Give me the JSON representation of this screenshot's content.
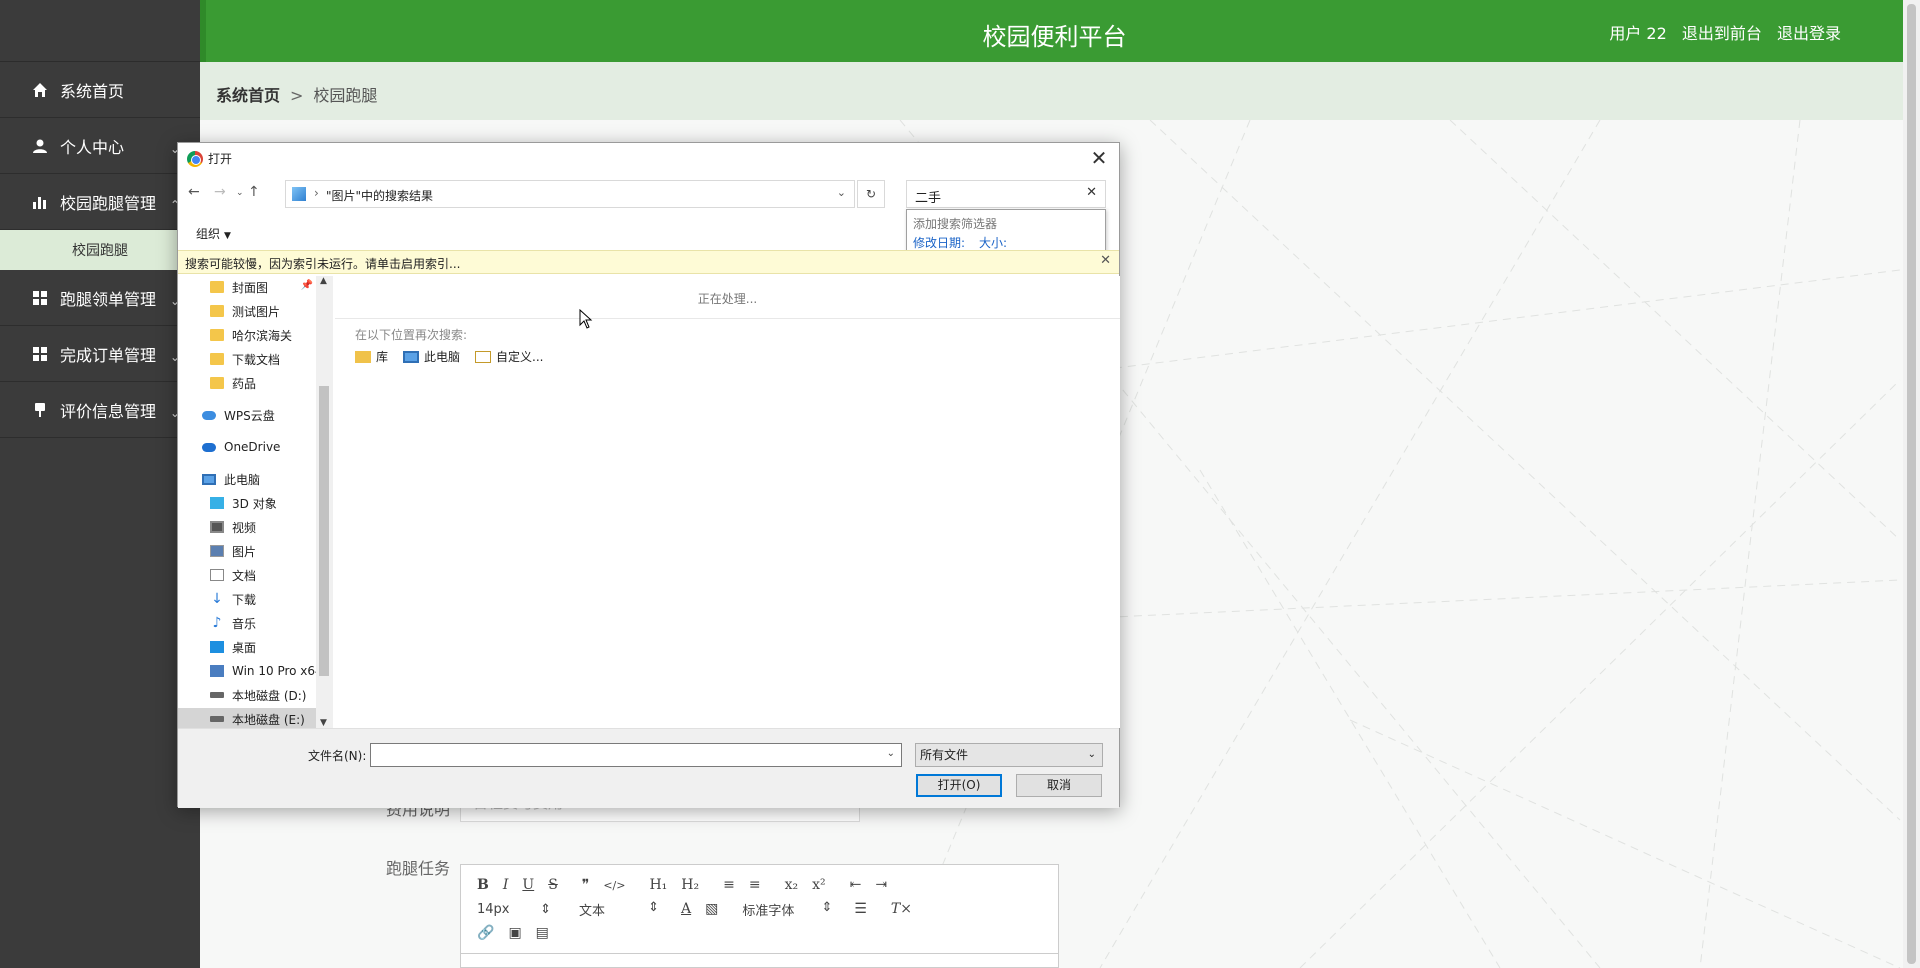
{
  "app": {
    "title": "校园便利平台",
    "user": "用户 22",
    "to_front": "退出到前台",
    "logout": "退出登录"
  },
  "sidebar": {
    "items": [
      {
        "label": "系统首页",
        "icon": "home-icon"
      },
      {
        "label": "个人中心",
        "icon": "user-icon"
      },
      {
        "label": "校园跑腿管理",
        "icon": "bar-chart-icon"
      },
      {
        "label": "跑腿领单管理",
        "icon": "grid-icon"
      },
      {
        "label": "完成订单管理",
        "icon": "grid-icon"
      },
      {
        "label": "评价信息管理",
        "icon": "pin-icon"
      }
    ],
    "sub_item": "校园跑腿"
  },
  "breadcrumb": {
    "home": "系统首页",
    "separator": ">",
    "current": "校园跑腿"
  },
  "form": {
    "fee_label": "费用说明",
    "fee_placeholder": "日程费与费用",
    "task_label": "跑腿任务",
    "editor": {
      "font_size": "14px",
      "block_type": "文本",
      "font_family": "标准字体",
      "toolbar_buttons": [
        "B",
        "I",
        "U",
        "S",
        "❞",
        "</>",
        "H₁",
        "H₂",
        "≡",
        "≡",
        "x₂",
        "x²",
        "⇤",
        "⇥"
      ]
    }
  },
  "dialog": {
    "title": "打开",
    "close": "✕",
    "path": "\"图片\"中的搜索结果",
    "search_value": "二手",
    "search_popup": {
      "title": "添加搜索筛选器",
      "filter_date": "修改日期:",
      "filter_size": "大小:"
    },
    "organize": "组织",
    "info_bar": "搜索可能较慢，因为索引未运行。请单击启用索引...",
    "tree": [
      {
        "label": "封面图",
        "icon": "folder-icon"
      },
      {
        "label": "测试图片",
        "icon": "folder-icon"
      },
      {
        "label": "哈尔滨海关",
        "icon": "folder-icon"
      },
      {
        "label": "下载文档",
        "icon": "folder-icon"
      },
      {
        "label": "药品",
        "icon": "folder-icon"
      },
      {
        "label": "WPS云盘",
        "icon": "cloud-icon"
      },
      {
        "label": "OneDrive",
        "icon": "onedrive-icon"
      },
      {
        "label": "此电脑",
        "icon": "computer-icon"
      },
      {
        "label": "3D 对象",
        "icon": "cube-icon"
      },
      {
        "label": "视频",
        "icon": "video-icon"
      },
      {
        "label": "图片",
        "icon": "picture-icon"
      },
      {
        "label": "文档",
        "icon": "document-icon"
      },
      {
        "label": "下载",
        "icon": "download-icon"
      },
      {
        "label": "音乐",
        "icon": "music-icon"
      },
      {
        "label": "桌面",
        "icon": "desktop-icon"
      },
      {
        "label": "Win 10 Pro x64",
        "icon": "windows-drive-icon"
      },
      {
        "label": "本地磁盘 (D:)",
        "icon": "disk-icon"
      },
      {
        "label": "本地磁盘 (E:)",
        "icon": "disk-icon"
      }
    ],
    "processing": "正在处理...",
    "search_again": "在以下位置再次搜索:",
    "locations": [
      "库",
      "此电脑",
      "自定义..."
    ],
    "filename_label": "文件名(N):",
    "filename_value": "",
    "filetype": "所有文件",
    "open_button": "打开(O)",
    "cancel_button": "取消"
  }
}
